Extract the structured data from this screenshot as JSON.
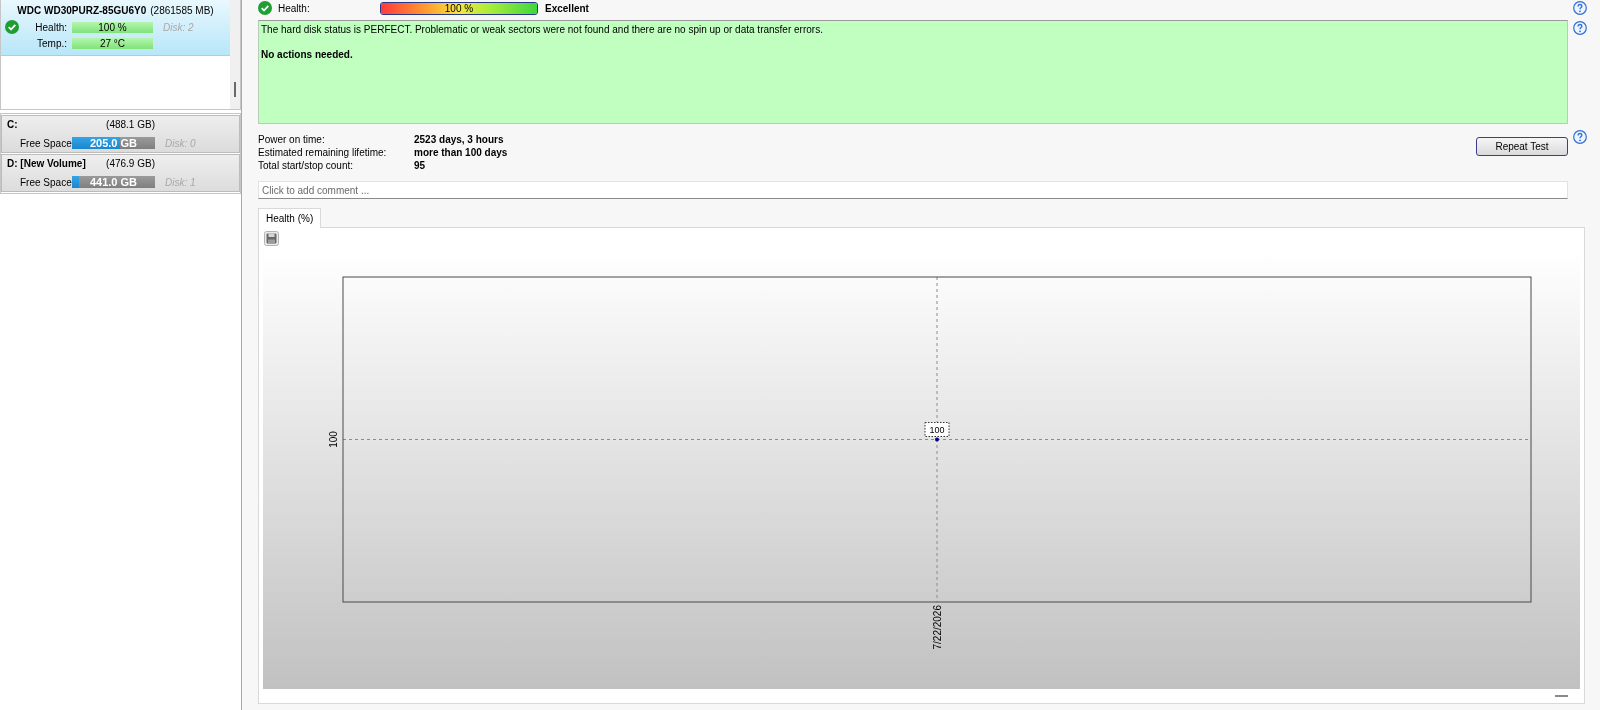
{
  "disks": [
    {
      "name": "WDC WD30PURZ-85GU6Y0",
      "capacity": "(2861585 MB)",
      "selected": true,
      "metrics": [
        {
          "label": "Health:",
          "value": "100 %",
          "level": 1
        },
        {
          "label": "Temp.:",
          "value": "27 °C",
          "level": 1
        }
      ],
      "disk_number": "Disk: 2"
    }
  ],
  "partitions": [
    {
      "name": "C:",
      "capacity": "(488.1 GB)",
      "selected": false,
      "free_label": "Free Space",
      "free_value": "205.0 GB",
      "level": 0.58,
      "disk_number": "Disk: 0"
    },
    {
      "name": "D: [New Volume]",
      "capacity": "(476.9 GB)",
      "selected": false,
      "free_label": "Free Space",
      "free_value": "441.0 GB",
      "level": 0.08,
      "disk_number": "Disk: 1"
    }
  ],
  "health": {
    "label": "Health:",
    "value": "100 %",
    "level": 1,
    "rating": "Excellent"
  },
  "message": {
    "text": "The hard disk status is PERFECT. Problematic or weak sectors were not found and there are no spin up or data transfer errors.",
    "action": "No actions needed."
  },
  "details": [
    {
      "label": "Power on time:",
      "value": "2523 days, 3 hours"
    },
    {
      "label": "Estimated remaining lifetime:",
      "value": "more than 100 days"
    },
    {
      "label": "Total start/stop count:",
      "value": "95"
    }
  ],
  "repeat_button": {
    "label": "Repeat Test"
  },
  "comment": {
    "placeholder": "Click to add comment ..."
  },
  "tabs": [
    {
      "label": "Health (%)",
      "selected": true
    }
  ],
  "chart": {
    "y_axis_label": "100",
    "x_axis_label": "7/22/2026",
    "point_label": "100"
  }
}
